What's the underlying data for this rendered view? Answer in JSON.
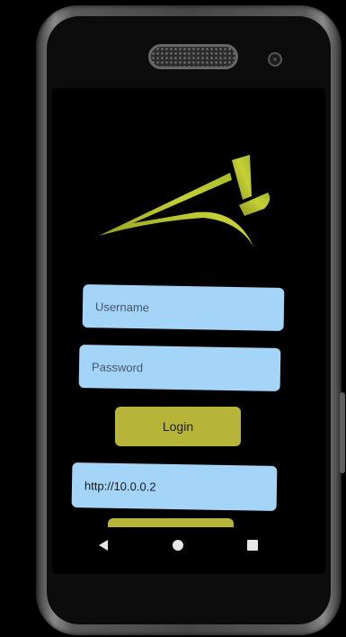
{
  "login_form": {
    "username_placeholder": "Username",
    "password_placeholder": "Password",
    "login_label": "Login",
    "server_url": "http://10.0.0.2"
  },
  "nav": {
    "back_icon": "back-triangle-icon",
    "home_icon": "home-circle-icon",
    "recents_icon": "recents-square-icon"
  },
  "colors": {
    "input_background": "#a4d4f7",
    "login_button": "#b6b53a",
    "logo_accent": "#c7cf35",
    "screen_background": "#000000"
  }
}
